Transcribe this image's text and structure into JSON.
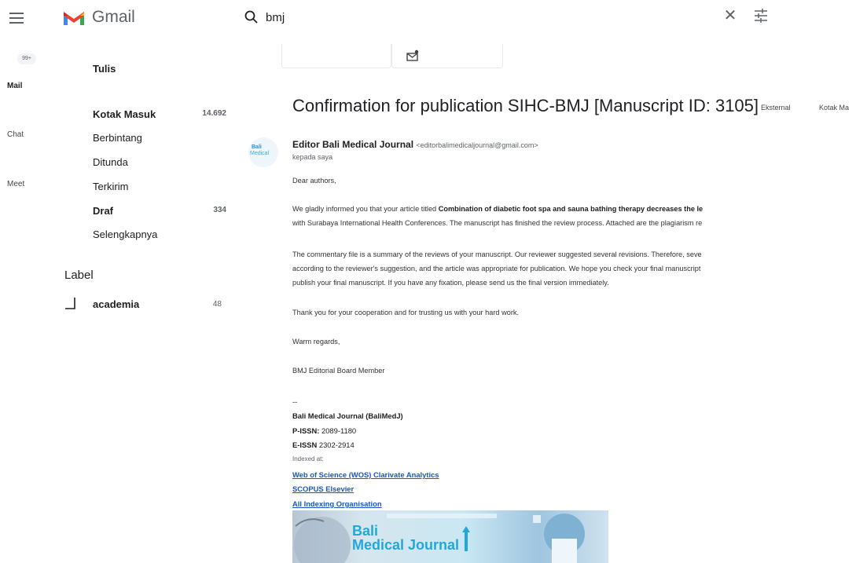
{
  "header": {
    "app_name": "Gmail",
    "search_value": "bmj",
    "clear_symbol": "✕",
    "icons": [
      "menu-icon",
      "gmail-logo",
      "search-icon",
      "close-icon",
      "tune-icon"
    ]
  },
  "rail": {
    "badge": "99+",
    "items": [
      {
        "label": "Mail"
      },
      {
        "label": "Chat"
      },
      {
        "label": "Meet"
      }
    ]
  },
  "sidebar": {
    "compose_label": "Tulis",
    "nav": [
      {
        "label": "Kotak Masuk",
        "count": "14.692",
        "bold": true
      },
      {
        "label": "Berbintang",
        "count": ""
      },
      {
        "label": "Ditunda",
        "count": ""
      },
      {
        "label": "Terkirim",
        "count": ""
      },
      {
        "label": "Draf",
        "count": "334",
        "bold": true
      },
      {
        "label": "Selengkapnya",
        "count": ""
      }
    ],
    "labels_heading": "Label",
    "labels": [
      {
        "name": "academia",
        "count": "48"
      }
    ]
  },
  "message": {
    "subject": "Confirmation for publication SIHC-BMJ [Manuscript ID: 3105]",
    "chips": [
      "Eksternal",
      "Kotak Ma"
    ],
    "avatar_line1": "Bali",
    "avatar_line2": "Medical",
    "sender_name": "Editor Bali Medical Journal",
    "sender_email": "<editorbalimedicaljournal@gmail.com>",
    "to_line": "kepada saya",
    "greeting": "Dear authors,",
    "p1_pre": "We gladly informed you that your article titled ",
    "p1_bold": "Combination of diabetic foot spa and sauna bathing therapy decreases the le",
    "p1_line2": "with Surabaya International Health Conferences. The manuscript has finished the review process. Attached are the plagiarism re",
    "p2_line1": "The commentary file is a summary of the reviews of your manuscript. Our reviewer suggested several revisions. Therefore, seve",
    "p2_line2": "according to the reviewer's suggestion, and the article was appropriate for publication. We hope you check your final manuscript",
    "p2_line3": "publish your final manuscript. If you have any fixation, please send us the final version immediately.",
    "p3": "Thank you for your cooperation and for trusting us with your hard work.",
    "closing": "Warm regards,",
    "signer": "BMJ Editorial Board Member",
    "sig_dash": "--",
    "journal_name": "Bali Medical Journal (BaliMedJ)",
    "pissn_label": "P-ISSN:",
    "pissn": "2089-1180",
    "eissn_label": "E-ISSN",
    "eissn": "2302-2914",
    "indexed_label": "Indexed at:",
    "links": [
      "Web of Science (WOS) Clarivate Analytics",
      "SCOPUS Elsevier",
      "All Indexing Organisation"
    ],
    "banner_line1": "Bali",
    "banner_line2": "Medical Journal"
  },
  "colors": {
    "link": "#1a56c4",
    "gmail_red": "#ea4335",
    "banner_text": "#21a8d8"
  }
}
